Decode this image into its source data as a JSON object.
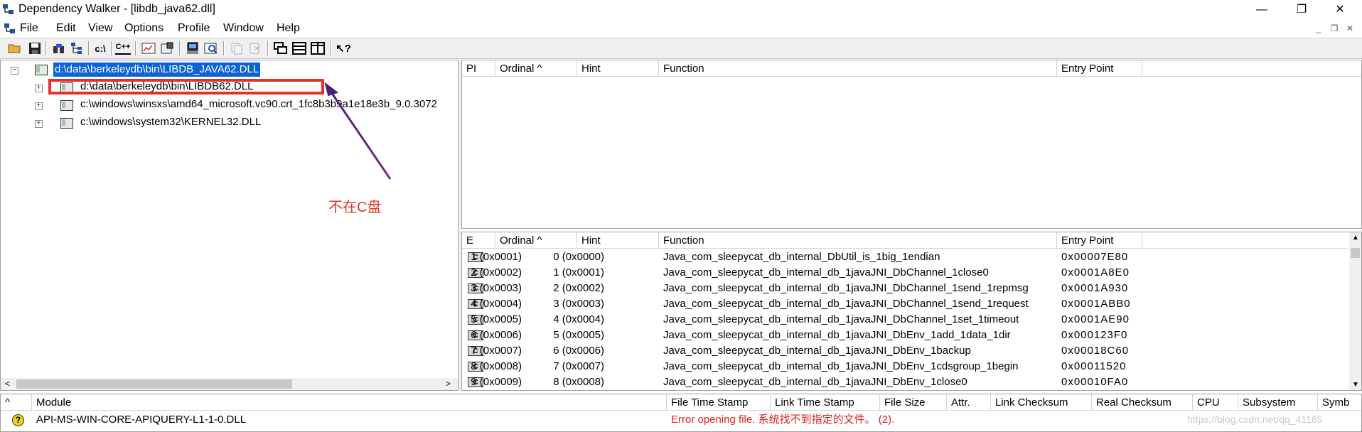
{
  "window": {
    "title": "Dependency Walker - [libdb_java62.dll]",
    "controls": {
      "minimize": "—",
      "restore": "❐",
      "close": "✕"
    }
  },
  "menu": [
    "File",
    "Edit",
    "View",
    "Options",
    "Profile",
    "Window",
    "Help"
  ],
  "toolbar_icons": [
    "open-icon",
    "save-icon",
    "find-icon",
    "module-tree-icon",
    "c-path-icon",
    "cpp-undecorate-icon",
    "profile-icon",
    "properties-icon",
    "system-info-icon",
    "view-module-icon",
    "copy-icon",
    "refresh-icon",
    "cascade-icon",
    "tile-horizontal-icon",
    "tile-vertical-icon",
    "help-icon"
  ],
  "toolbar_text": {
    "c_path": "c:\\",
    "cpp": "C++"
  },
  "tree": {
    "root": "d:\\data\\berkeleydb\\bin\\LIBDB_JAVA62.DLL",
    "children": [
      "d:\\data\\berkeleydb\\bin\\LIBDB62.DLL",
      "c:\\windows\\winsxs\\amd64_microsoft.vc90.crt_1fc8b3b9a1e18e3b_9.0.3072",
      "c:\\windows\\system32\\KERNEL32.DLL"
    ]
  },
  "annotation": {
    "text": "不在C盘",
    "color": "#e8302a",
    "arrow_color": "#7b2b8c"
  },
  "parent_imports": {
    "headers": [
      "PI",
      "Ordinal ^",
      "Hint",
      "Function",
      "Entry Point"
    ]
  },
  "exports": {
    "headers": [
      "E",
      "Ordinal ^",
      "Hint",
      "Function",
      "Entry Point"
    ],
    "icon_text": "C",
    "rows": [
      {
        "ordinal": "1 (0x0001)",
        "hint": "0 (0x0000)",
        "function": "Java_com_sleepycat_db_internal_DbUtil_is_1big_1endian",
        "entry": "0x00007E80"
      },
      {
        "ordinal": "2 (0x0002)",
        "hint": "1 (0x0001)",
        "function": "Java_com_sleepycat_db_internal_db_1javaJNI_DbChannel_1close0",
        "entry": "0x0001A8E0"
      },
      {
        "ordinal": "3 (0x0003)",
        "hint": "2 (0x0002)",
        "function": "Java_com_sleepycat_db_internal_db_1javaJNI_DbChannel_1send_1repmsg",
        "entry": "0x0001A930"
      },
      {
        "ordinal": "4 (0x0004)",
        "hint": "3 (0x0003)",
        "function": "Java_com_sleepycat_db_internal_db_1javaJNI_DbChannel_1send_1request",
        "entry": "0x0001ABB0"
      },
      {
        "ordinal": "5 (0x0005)",
        "hint": "4 (0x0004)",
        "function": "Java_com_sleepycat_db_internal_db_1javaJNI_DbChannel_1set_1timeout",
        "entry": "0x0001AE90"
      },
      {
        "ordinal": "6 (0x0006)",
        "hint": "5 (0x0005)",
        "function": "Java_com_sleepycat_db_internal_db_1javaJNI_DbEnv_1add_1data_1dir",
        "entry": "0x000123F0"
      },
      {
        "ordinal": "7 (0x0007)",
        "hint": "6 (0x0006)",
        "function": "Java_com_sleepycat_db_internal_db_1javaJNI_DbEnv_1backup",
        "entry": "0x00018C60"
      },
      {
        "ordinal": "8 (0x0008)",
        "hint": "7 (0x0007)",
        "function": "Java_com_sleepycat_db_internal_db_1javaJNI_DbEnv_1cdsgroup_1begin",
        "entry": "0x00011520"
      },
      {
        "ordinal": "9 (0x0009)",
        "hint": "8 (0x0008)",
        "function": "Java_com_sleepycat_db_internal_db_1javaJNI_DbEnv_1close0",
        "entry": "0x00010FA0"
      }
    ]
  },
  "modules": {
    "headers": [
      "^",
      "Module",
      "File Time Stamp",
      "Link Time Stamp",
      "File Size",
      "Attr.",
      "Link Checksum",
      "Real Checksum",
      "CPU",
      "Subsystem",
      "Symb"
    ],
    "rows": [
      {
        "status_icon": "?",
        "module": "API-MS-WIN-CORE-APIQUERY-L1-1-0.DLL",
        "message": "Error opening file. 系统找不到指定的文件。 (2)."
      }
    ]
  },
  "watermark": "https://blog.csdn.net/qq_41165"
}
